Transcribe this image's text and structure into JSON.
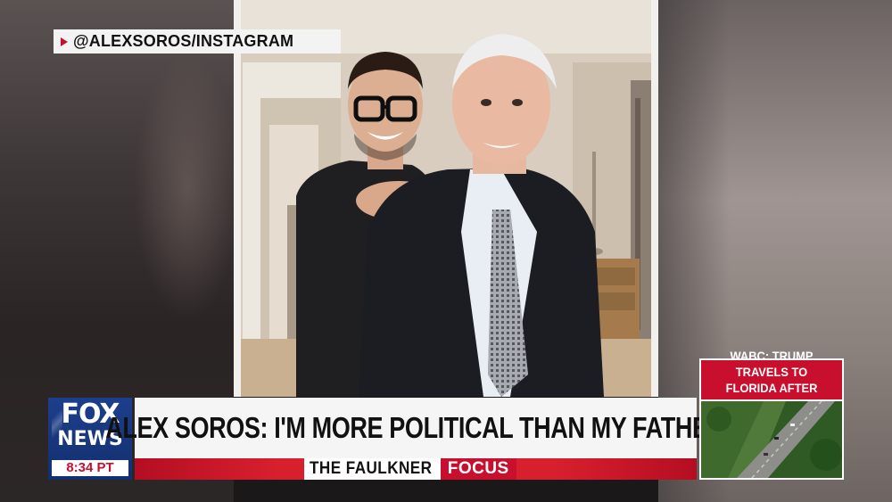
{
  "source_tag": {
    "text": "@ALEXSOROS/INSTAGRAM",
    "icon": "play-icon"
  },
  "logo": {
    "line1": "FOX",
    "line2": "NEWS",
    "time": "8:34 PT"
  },
  "headline": "ALEX SOROS: I'M MORE POLITICAL THAN MY FATHER",
  "show": {
    "name": "THE FAULKNER",
    "focus": "FOCUS"
  },
  "side_box": {
    "line1": "WABC: TRUMP TRAVELS TO",
    "line2": "FLORIDA AFTER INDICTMENT"
  },
  "colors": {
    "fox_red": "#c8102e",
    "fox_blue": "#1d3e8c",
    "headline_bg": "#f5f5f5"
  }
}
